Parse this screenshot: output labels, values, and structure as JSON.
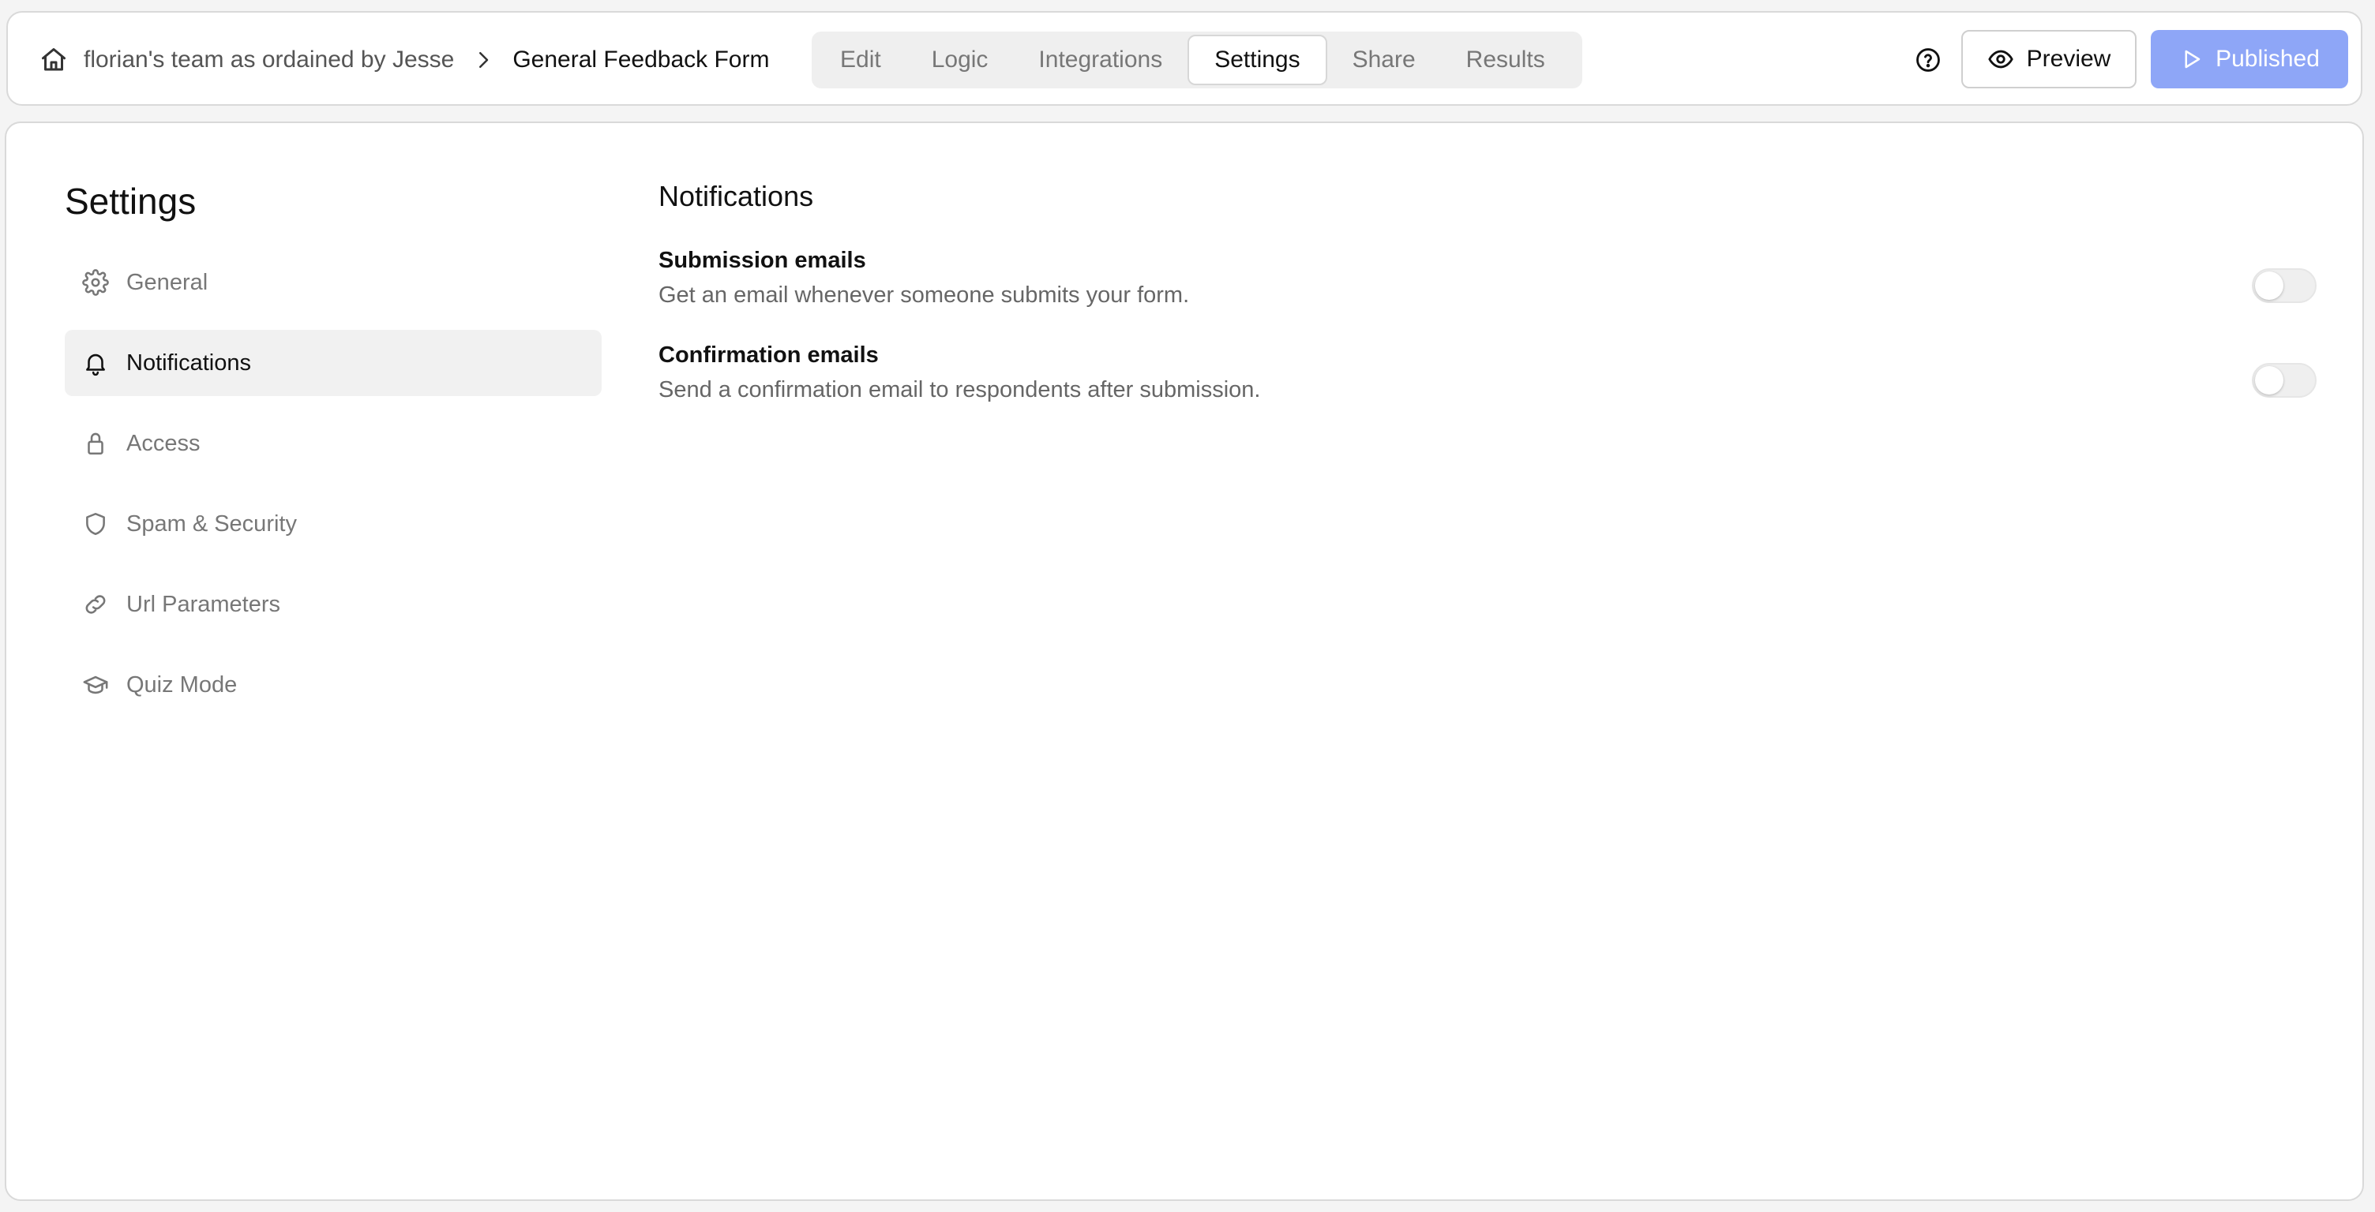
{
  "breadcrumb": {
    "team": "florian's team as ordained by Jesse",
    "form": "General Feedback Form"
  },
  "tabs": [
    {
      "label": "Edit"
    },
    {
      "label": "Logic"
    },
    {
      "label": "Integrations"
    },
    {
      "label": "Settings",
      "active": true
    },
    {
      "label": "Share"
    },
    {
      "label": "Results"
    }
  ],
  "actions": {
    "preview_label": "Preview",
    "publish_label": "Published",
    "publish_color": "#8ea6f7"
  },
  "sidebar": {
    "title": "Settings",
    "items": [
      {
        "label": "General",
        "icon": "gear-icon"
      },
      {
        "label": "Notifications",
        "icon": "bell-icon",
        "active": true
      },
      {
        "label": "Access",
        "icon": "lock-icon"
      },
      {
        "label": "Spam & Security",
        "icon": "shield-icon"
      },
      {
        "label": "Url Parameters",
        "icon": "link-icon"
      },
      {
        "label": "Quiz Mode",
        "icon": "graduation-cap-icon"
      }
    ]
  },
  "notifications": {
    "title": "Notifications",
    "settings": [
      {
        "name": "Submission emails",
        "description": "Get an email whenever someone submits your form.",
        "enabled": false
      },
      {
        "name": "Confirmation emails",
        "description": "Send a confirmation email to respondents after submission.",
        "enabled": false
      }
    ]
  }
}
